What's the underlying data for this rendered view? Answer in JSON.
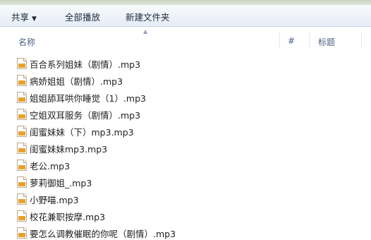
{
  "toolbar": {
    "share_label": "共享",
    "play_all_label": "全部播放",
    "new_folder_label": "新建文件夹"
  },
  "columns": {
    "name": "名称",
    "number": "#",
    "title": "标题"
  },
  "files": [
    {
      "name": "百合系列姐妹（剧情）.mp3"
    },
    {
      "name": "病娇姐姐（剧情）.mp3"
    },
    {
      "name": "姐姐舔耳哄你睡觉（1）.mp3"
    },
    {
      "name": "空姐双耳服务（剧情）.mp3"
    },
    {
      "name": "闺蜜妹妹（下）mp3.mp3"
    },
    {
      "name": "闺蜜妹妹mp3.mp3"
    },
    {
      "name": "老公.mp3"
    },
    {
      "name": "萝莉御姐_.mp3"
    },
    {
      "name": "小野喵.mp3"
    },
    {
      "name": "校花兼职按摩.mp3"
    },
    {
      "name": "要怎么调教催眠的你呢（剧情）.mp3"
    }
  ],
  "icons": {
    "file": "mp3-file-icon",
    "dropdown": "chevron-down-icon",
    "sort": "sort-caret-icon"
  }
}
